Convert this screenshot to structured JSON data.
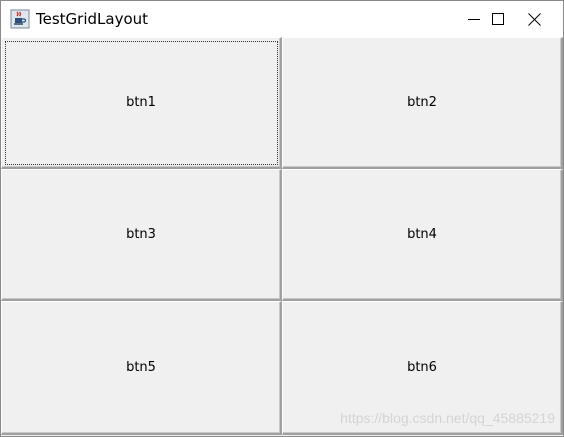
{
  "window": {
    "title": "TestGridLayout",
    "app_icon": "java-cup-icon",
    "controls": {
      "minimize_icon": "minimize-icon",
      "maximize_icon": "maximize-icon",
      "close_icon": "close-icon"
    }
  },
  "grid": {
    "buttons": [
      {
        "label": "btn1",
        "focused": true
      },
      {
        "label": "btn2",
        "focused": false
      },
      {
        "label": "btn3",
        "focused": false
      },
      {
        "label": "btn4",
        "focused": false
      },
      {
        "label": "btn5",
        "focused": false
      },
      {
        "label": "btn6",
        "focused": false
      }
    ]
  },
  "watermark": {
    "text": "https://blog.csdn.net/qq_45885219"
  },
  "colors": {
    "titlebar_bg": "#ffffff",
    "content_bg": "#f0f0f0",
    "button_shadow": "#a0a0a0"
  }
}
